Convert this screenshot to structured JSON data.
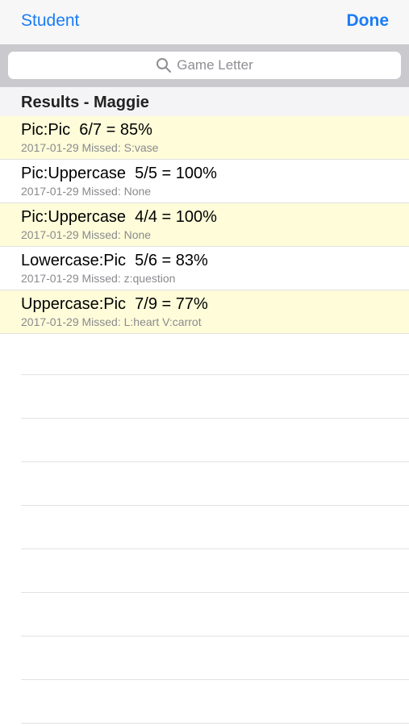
{
  "navbar": {
    "back_label": "Student",
    "done_label": "Done"
  },
  "search": {
    "placeholder": "Game Letter",
    "icon": "search-icon"
  },
  "section": {
    "title": "Results - Maggie"
  },
  "results": [
    {
      "title": "Pic:Pic  6/7 = 85%",
      "detail": "2017-01-29 Missed: S:vase",
      "highlighted": true
    },
    {
      "title": "Pic:Uppercase  5/5 = 100%",
      "detail": "2017-01-29 Missed: None",
      "highlighted": false
    },
    {
      "title": "Pic:Uppercase  4/4 = 100%",
      "detail": "2017-01-29 Missed: None",
      "highlighted": true
    },
    {
      "title": "Lowercase:Pic  5/6 = 83%",
      "detail": "2017-01-29 Missed: z:question",
      "highlighted": false
    },
    {
      "title": "Uppercase:Pic  7/9 = 77%",
      "detail": "2017-01-29 Missed: L:heart V:carrot",
      "highlighted": true
    }
  ],
  "colors": {
    "accent": "#1a7cf5",
    "highlight_row": "#fefcd9",
    "separator": "#e2e2e2"
  }
}
